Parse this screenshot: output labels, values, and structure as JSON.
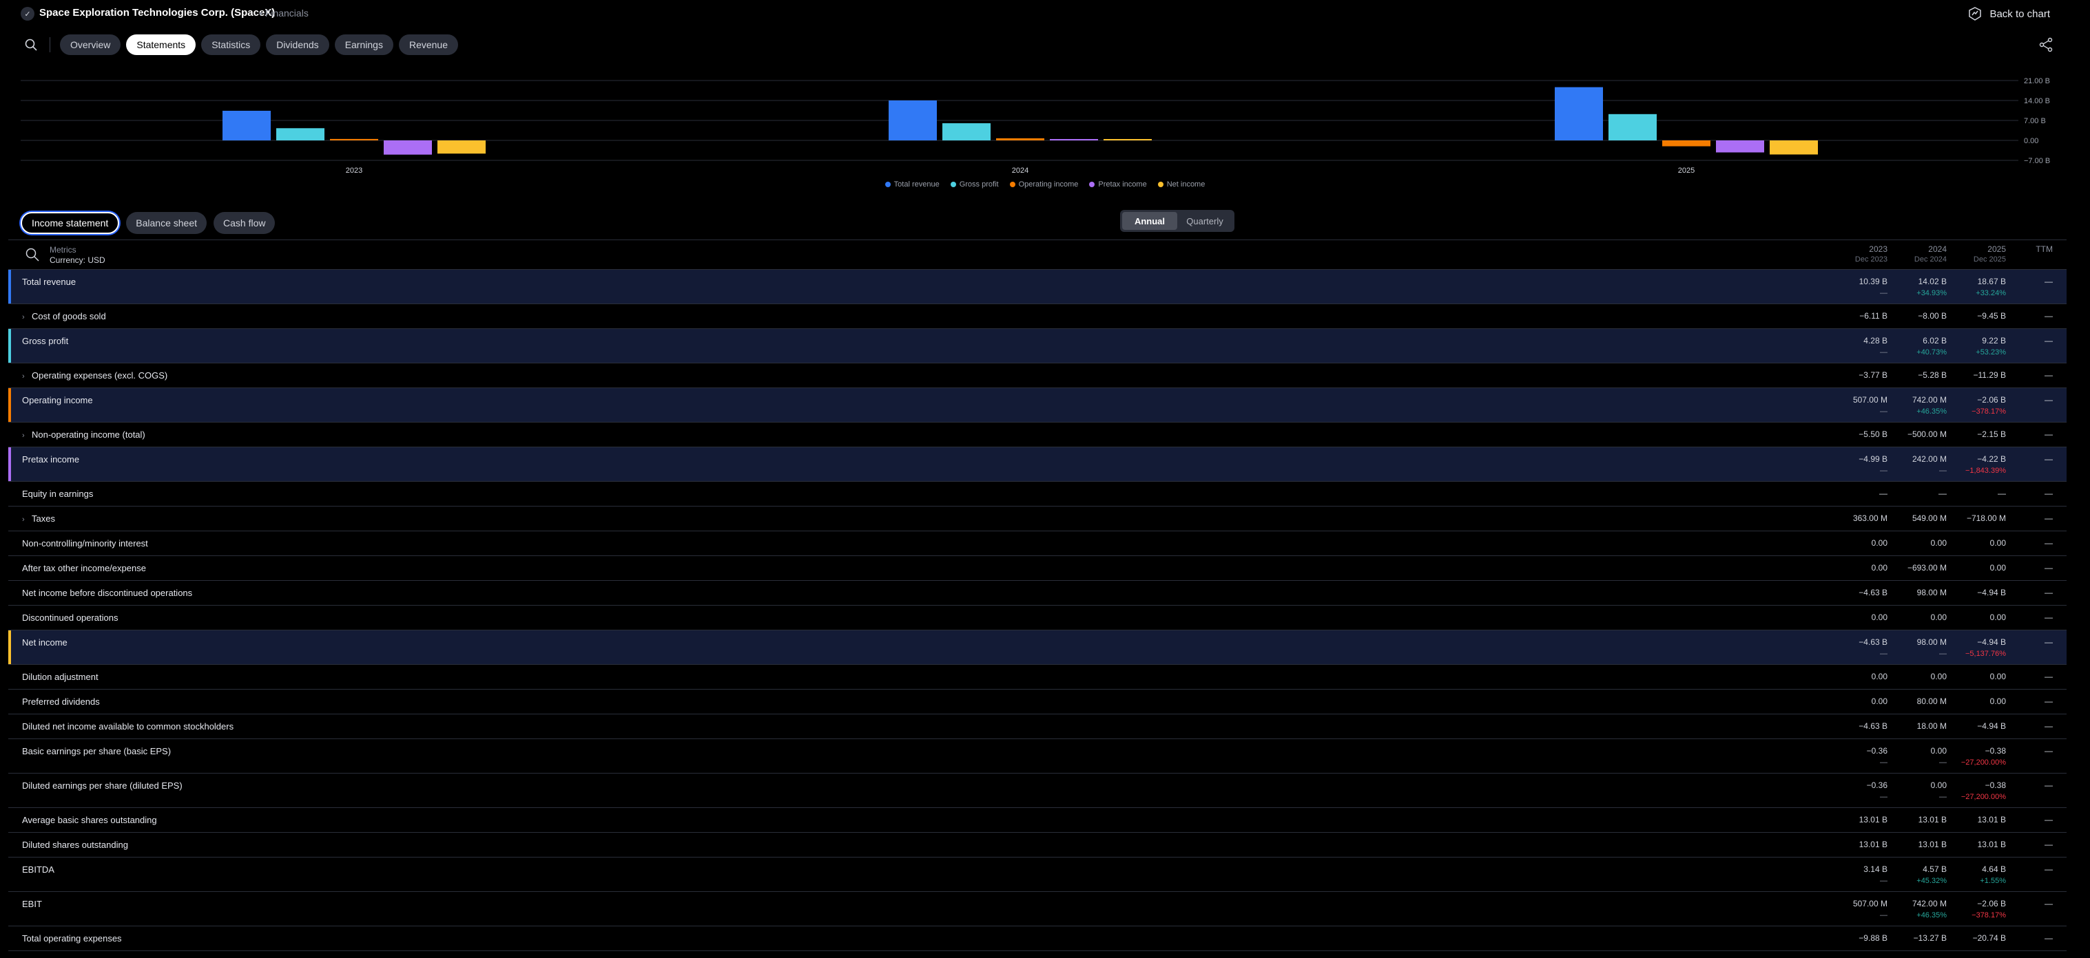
{
  "header": {
    "company": "Space Exploration Technologies Corp. (SpaceX)",
    "section": "• Financials",
    "back_label": "Back to chart"
  },
  "nav": {
    "tabs": [
      {
        "label": "Overview",
        "active": false
      },
      {
        "label": "Statements",
        "active": true
      },
      {
        "label": "Statistics",
        "active": false
      },
      {
        "label": "Dividends",
        "active": false
      },
      {
        "label": "Earnings",
        "active": false
      },
      {
        "label": "Revenue",
        "active": false
      }
    ]
  },
  "chart_data": {
    "type": "bar",
    "categories": [
      "2023",
      "2024",
      "2025"
    ],
    "series": [
      {
        "name": "Total revenue",
        "color": "#3179f5",
        "values": [
          10.39,
          14.02,
          18.67
        ]
      },
      {
        "name": "Gross profit",
        "color": "#4dd0e1",
        "values": [
          4.28,
          6.02,
          9.22
        ]
      },
      {
        "name": "Operating income",
        "color": "#f57c00",
        "values": [
          0.507,
          0.742,
          -2.06
        ]
      },
      {
        "name": "Pretax income",
        "color": "#ab6ef5",
        "values": [
          -4.99,
          0.242,
          -4.22
        ]
      },
      {
        "name": "Net income",
        "color": "#fbc02d",
        "values": [
          -4.63,
          0.098,
          -4.94
        ]
      }
    ],
    "yticks": [
      "21.00 B",
      "14.00 B",
      "7.00 B",
      "0.00",
      "−7.00 B"
    ],
    "ylim": [
      -7,
      21
    ],
    "grid": true,
    "legend": "bottom"
  },
  "statement_tabs": [
    {
      "label": "Income statement",
      "active": true
    },
    {
      "label": "Balance sheet",
      "active": false
    },
    {
      "label": "Cash flow",
      "active": false
    }
  ],
  "period": {
    "annual": "Annual",
    "quarterly": "Quarterly"
  },
  "table": {
    "metrics_label": "Metrics",
    "currency_label": "Currency: USD",
    "columns": [
      {
        "year": "2023",
        "date": "Dec 2023"
      },
      {
        "year": "2024",
        "date": "Dec 2024"
      },
      {
        "year": "2025",
        "date": "Dec 2025"
      }
    ],
    "ttm_label": "TTM",
    "rows": [
      {
        "label": "Total revenue",
        "hl": true,
        "accent": "#3179f5",
        "expand": false,
        "values": [
          "10.39 B",
          "14.02 B",
          "18.67 B"
        ],
        "changes": [
          [
            "—",
            "neu"
          ],
          [
            "+34.93%",
            "pos"
          ],
          [
            "+33.24%",
            "pos"
          ]
        ],
        "ttm": "—"
      },
      {
        "label": "Cost of goods sold",
        "hl": false,
        "expand": true,
        "values": [
          "−6.11 B",
          "−8.00 B",
          "−9.45 B"
        ],
        "ttm": "—"
      },
      {
        "label": "Gross profit",
        "hl": true,
        "accent": "#4dd0e1",
        "expand": false,
        "values": [
          "4.28 B",
          "6.02 B",
          "9.22 B"
        ],
        "changes": [
          [
            "—",
            "neu"
          ],
          [
            "+40.73%",
            "pos"
          ],
          [
            "+53.23%",
            "pos"
          ]
        ],
        "ttm": "—"
      },
      {
        "label": "Operating expenses (excl. COGS)",
        "hl": false,
        "expand": true,
        "values": [
          "−3.77 B",
          "−5.28 B",
          "−11.29 B"
        ],
        "ttm": "—"
      },
      {
        "label": "Operating income",
        "hl": true,
        "accent": "#f57c00",
        "expand": false,
        "values": [
          "507.00 M",
          "742.00 M",
          "−2.06 B"
        ],
        "changes": [
          [
            "—",
            "neu"
          ],
          [
            "+46.35%",
            "pos"
          ],
          [
            "−378.17%",
            "neg"
          ]
        ],
        "ttm": "—"
      },
      {
        "label": "Non-operating income (total)",
        "hl": false,
        "expand": true,
        "values": [
          "−5.50 B",
          "−500.00 M",
          "−2.15 B"
        ],
        "ttm": "—"
      },
      {
        "label": "Pretax income",
        "hl": true,
        "accent": "#ab6ef5",
        "expand": false,
        "values": [
          "−4.99 B",
          "242.00 M",
          "−4.22 B"
        ],
        "changes": [
          [
            "—",
            "neu"
          ],
          [
            "—",
            "neu"
          ],
          [
            "−1,843.39%",
            "neg"
          ]
        ],
        "ttm": "—"
      },
      {
        "label": "Equity in earnings",
        "hl": false,
        "expand": false,
        "values": [
          "—",
          "—",
          "—"
        ],
        "ttm": "—"
      },
      {
        "label": "Taxes",
        "hl": false,
        "expand": true,
        "values": [
          "363.00 M",
          "549.00 M",
          "−718.00 M"
        ],
        "ttm": "—"
      },
      {
        "label": "Non-controlling/minority interest",
        "hl": false,
        "expand": false,
        "values": [
          "0.00",
          "0.00",
          "0.00"
        ],
        "ttm": "—"
      },
      {
        "label": "After tax other income/expense",
        "hl": false,
        "expand": false,
        "values": [
          "0.00",
          "−693.00 M",
          "0.00"
        ],
        "ttm": "—"
      },
      {
        "label": "Net income before discontinued operations",
        "hl": false,
        "expand": false,
        "values": [
          "−4.63 B",
          "98.00 M",
          "−4.94 B"
        ],
        "ttm": "—"
      },
      {
        "label": "Discontinued operations",
        "hl": false,
        "expand": false,
        "values": [
          "0.00",
          "0.00",
          "0.00"
        ],
        "ttm": "—"
      },
      {
        "label": "Net income",
        "hl": true,
        "accent": "#fbc02d",
        "expand": false,
        "values": [
          "−4.63 B",
          "98.00 M",
          "−4.94 B"
        ],
        "changes": [
          [
            "—",
            "neu"
          ],
          [
            "—",
            "neu"
          ],
          [
            "−5,137.76%",
            "neg"
          ]
        ],
        "ttm": "—"
      },
      {
        "label": "Dilution adjustment",
        "hl": false,
        "expand": false,
        "values": [
          "0.00",
          "0.00",
          "0.00"
        ],
        "ttm": "—"
      },
      {
        "label": "Preferred dividends",
        "hl": false,
        "expand": false,
        "values": [
          "0.00",
          "80.00 M",
          "0.00"
        ],
        "ttm": "—"
      },
      {
        "label": "Diluted net income available to common stockholders",
        "hl": false,
        "expand": false,
        "values": [
          "−4.63 B",
          "18.00 M",
          "−4.94 B"
        ],
        "ttm": "—"
      },
      {
        "label": "Basic earnings per share (basic EPS)",
        "hl": false,
        "expand": false,
        "values": [
          "−0.36",
          "0.00",
          "−0.38"
        ],
        "changes": [
          [
            "—",
            "neu"
          ],
          [
            "—",
            "neu"
          ],
          [
            "−27,200.00%",
            "neg"
          ]
        ],
        "ttm": "—"
      },
      {
        "label": "Diluted earnings per share (diluted EPS)",
        "hl": false,
        "expand": false,
        "values": [
          "−0.36",
          "0.00",
          "−0.38"
        ],
        "changes": [
          [
            "—",
            "neu"
          ],
          [
            "—",
            "neu"
          ],
          [
            "−27,200.00%",
            "neg"
          ]
        ],
        "ttm": "—"
      },
      {
        "label": "Average basic shares outstanding",
        "hl": false,
        "expand": false,
        "values": [
          "13.01 B",
          "13.01 B",
          "13.01 B"
        ],
        "ttm": "—"
      },
      {
        "label": "Diluted shares outstanding",
        "hl": false,
        "expand": false,
        "values": [
          "13.01 B",
          "13.01 B",
          "13.01 B"
        ],
        "ttm": "—"
      },
      {
        "label": "EBITDA",
        "hl": false,
        "expand": false,
        "values": [
          "3.14 B",
          "4.57 B",
          "4.64 B"
        ],
        "changes": [
          [
            "—",
            "neu"
          ],
          [
            "+45.32%",
            "pos"
          ],
          [
            "+1.55%",
            "pos"
          ]
        ],
        "ttm": "—"
      },
      {
        "label": "EBIT",
        "hl": false,
        "expand": false,
        "values": [
          "507.00 M",
          "742.00 M",
          "−2.06 B"
        ],
        "changes": [
          [
            "—",
            "neu"
          ],
          [
            "+46.35%",
            "pos"
          ],
          [
            "−378.17%",
            "neg"
          ]
        ],
        "ttm": "—"
      },
      {
        "label": "Total operating expenses",
        "hl": false,
        "expand": false,
        "values": [
          "−9.88 B",
          "−13.27 B",
          "−20.74 B"
        ],
        "ttm": "—"
      }
    ]
  }
}
